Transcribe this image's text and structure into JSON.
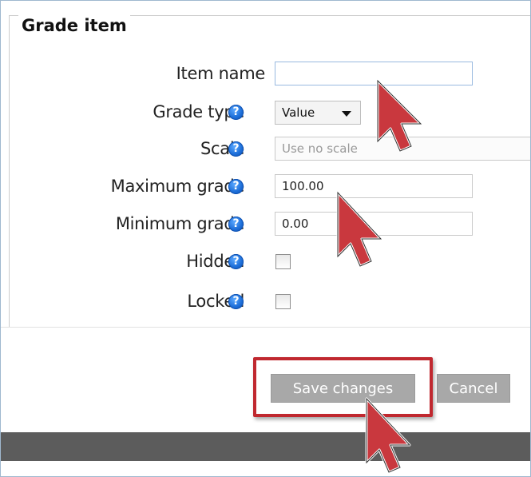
{
  "form": {
    "legend": "Grade item",
    "fields": {
      "item_name": {
        "label": "Item name",
        "value": ""
      },
      "grade_type": {
        "label": "Grade type",
        "selected": "Value"
      },
      "scale": {
        "label": "Scale",
        "placeholder": "Use no scale"
      },
      "maximum_grade": {
        "label": "Maximum grade",
        "value": "100.00"
      },
      "minimum_grade": {
        "label": "Minimum grade",
        "value": "0.00"
      },
      "hidden": {
        "label": "Hidden",
        "checked": false
      },
      "locked": {
        "label": "Locked",
        "checked": false
      }
    },
    "help_glyph": "?",
    "help_icon": "help-icon"
  },
  "buttons": {
    "save_label": "Save changes",
    "cancel_label": "Cancel"
  },
  "colors": {
    "highlight": "#c0282f",
    "help_icon": "#1e6fd9",
    "button": "#a8a8a8",
    "band": "#5c5c5c"
  }
}
